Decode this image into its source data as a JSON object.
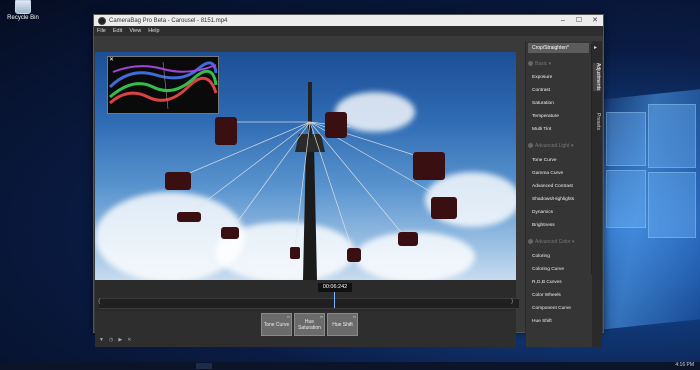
{
  "desktop": {
    "recycle_bin_label": "Recycle Bin",
    "clock": "4:16 PM"
  },
  "window": {
    "title": "CameraBag Pro Beta - Carousel - 8151.mp4",
    "controls": {
      "minimize": "–",
      "maximize": "☐",
      "close": "✕"
    }
  },
  "menu": [
    "File",
    "Edit",
    "View",
    "Help"
  ],
  "scope": {
    "close": "✕"
  },
  "timeline": {
    "timecode": "00:06:242",
    "playhead_fraction": 0.56
  },
  "effects": [
    {
      "label": "Tone Curve"
    },
    {
      "label": "Hue Saturation"
    },
    {
      "label": "Hue Shift"
    }
  ],
  "transport_icons": [
    "filter-icon",
    "clock-icon",
    "play-icon",
    "shuffle-icon"
  ],
  "panel": {
    "crop_label": "Crop/Straighten*",
    "basic_section": "Basic",
    "basic_items": [
      "Exposure",
      "Contrast",
      "Saturation",
      "Temperature",
      "Multi Tint"
    ],
    "advanced_light_section": "Advanced Light",
    "advanced_light_items": [
      "Tone Curve",
      "Gamma Curve",
      "Advanced Contrast",
      "Shadows/Highlights",
      "Dynamics",
      "Brightness"
    ],
    "advanced_color_section": "Advanced Color",
    "advanced_color_items": [
      "Coloring",
      "Coloring Curve",
      "R,G,B Curves",
      "Color Wheels",
      "Component Curve",
      "Hue Shift"
    ]
  },
  "side_tabs": {
    "arrow": "▸",
    "adjustments": "Adjustments",
    "presets": "Presets"
  }
}
